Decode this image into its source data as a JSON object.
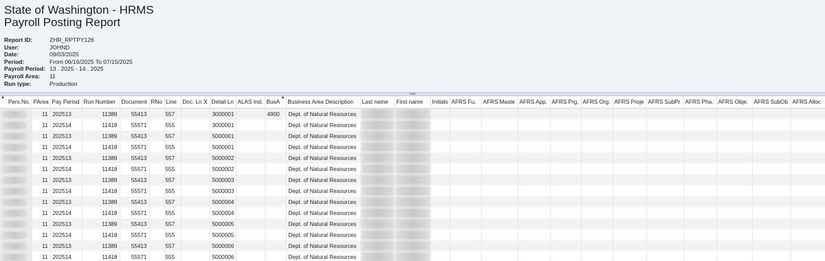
{
  "report": {
    "title_line1": "State of Washington - HRMS",
    "title_line2": "Payroll Posting Report",
    "meta": [
      {
        "label": "Report ID:",
        "value": "ZHR_RPTPY126"
      },
      {
        "label": "User:",
        "value": "JOHND"
      },
      {
        "label": "Date:",
        "value": "09/03/2025"
      },
      {
        "label": "Period:",
        "value": "From 06/16/2025 To 07/15/2025"
      },
      {
        "label": "Payroll Period:",
        "value": "13 . 2025 - 14 . 2025"
      },
      {
        "label": "Payroll Area:",
        "value": "11"
      },
      {
        "label": "Run type:",
        "value": "Production"
      }
    ]
  },
  "table": {
    "columns": [
      "Pers.No.",
      "PArea",
      "Pay Period",
      "Run Number",
      "Document",
      "RNo",
      "Line",
      "Doc. Ln X",
      "Detail Ln",
      "ALAS Ind.",
      "BusA",
      "Business Area Description",
      "Last name",
      "First name",
      "Initials",
      "AFRS Fu.",
      "AFRS Maste",
      "AFRS App.",
      "AFRS Prg.",
      "AFRS Org.",
      "AFRS Proje",
      "AFRS SubPr",
      "AFRS Pha.",
      "AFRS Obje.",
      "AFRS SubOb",
      "AFRS Alloc"
    ],
    "rows": [
      [
        "11",
        "202513",
        "11389",
        "55413",
        "557",
        "3000001",
        "4900",
        "Dept. of Natural Resources"
      ],
      [
        "11",
        "202514",
        "11418",
        "55571",
        "555",
        "3000001",
        "",
        "Dept. of Natural Resources"
      ],
      [
        "11",
        "202513",
        "11389",
        "55413",
        "557",
        "5000001",
        "",
        "Dept. of Natural Resources"
      ],
      [
        "11",
        "202514",
        "11418",
        "55571",
        "555",
        "5000001",
        "",
        "Dept. of Natural Resources"
      ],
      [
        "11",
        "202513",
        "11389",
        "55413",
        "557",
        "5000002",
        "",
        "Dept. of Natural Resources"
      ],
      [
        "11",
        "202514",
        "11418",
        "55571",
        "555",
        "5000002",
        "",
        "Dept. of Natural Resources"
      ],
      [
        "11",
        "202513",
        "11389",
        "55413",
        "557",
        "5000003",
        "",
        "Dept. of Natural Resources"
      ],
      [
        "11",
        "202514",
        "11418",
        "55571",
        "555",
        "5000003",
        "",
        "Dept. of Natural Resources"
      ],
      [
        "11",
        "202513",
        "11389",
        "55413",
        "557",
        "5000004",
        "",
        "Dept. of Natural Resources"
      ],
      [
        "11",
        "202514",
        "11418",
        "55571",
        "555",
        "5000004",
        "",
        "Dept. of Natural Resources"
      ],
      [
        "11",
        "202513",
        "11389",
        "55413",
        "557",
        "5000005",
        "",
        "Dept. of Natural Resources"
      ],
      [
        "11",
        "202514",
        "11418",
        "55571",
        "555",
        "5000005",
        "",
        "Dept. of Natural Resources"
      ],
      [
        "11",
        "202513",
        "11389",
        "55413",
        "557",
        "5000006",
        "",
        "Dept. of Natural Resources"
      ],
      [
        "11",
        "202514",
        "11418",
        "55571",
        "555",
        "5000006",
        "",
        "Dept. of Natural Resources"
      ]
    ]
  },
  "colors": {
    "sort_indicator": "#cc0000",
    "header_bg": "#eef3f7"
  }
}
